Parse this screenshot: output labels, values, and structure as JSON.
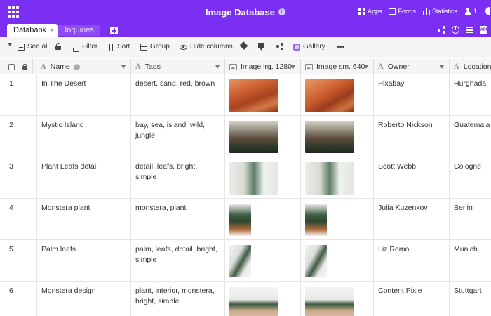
{
  "header": {
    "title": "Image Database",
    "apps_label": "Apps",
    "forms_label": "Forms",
    "statistics_label": "Statistics",
    "user_count": "1"
  },
  "tabs": [
    {
      "label": "Databank",
      "active": true
    },
    {
      "label": "Inquiries",
      "active": false
    }
  ],
  "toolbar": {
    "see_all": "See all",
    "filter": "Filter",
    "sort": "Sort",
    "group": "Group",
    "hide_columns": "Hide columns",
    "gallery": "Gallery"
  },
  "columns": {
    "name": "Name",
    "tags": "Tags",
    "image_lrg": "Image lrg. 1280",
    "image_sm": "Image sm. 640",
    "owner": "Owner",
    "location": "Location"
  },
  "rows": [
    {
      "num": "1",
      "name": "In The Desert",
      "tags": "desert, sand, red, brown",
      "owner": "Pixabay",
      "location": "Hurghada",
      "image": "desert"
    },
    {
      "num": "2",
      "name": "Mystic Island",
      "tags": "bay, sea, island, wild, jungle",
      "owner": "Roberto Nickson",
      "location": "Guatemala",
      "image": "island"
    },
    {
      "num": "3",
      "name": "Plant Leafs detail",
      "tags": "detail, leafs, bright, simple",
      "owner": "Scott Webb",
      "location": "Cologne",
      "image": "leaf"
    },
    {
      "num": "4",
      "name": "Monstera plant",
      "tags": "monstera, plant",
      "owner": "Julia Kuzenkov",
      "location": "Berlin",
      "image": "monstera"
    },
    {
      "num": "5",
      "name": "Palm leafs",
      "tags": "palm, leafs, detail, bright, simple",
      "owner": "Liz Romo",
      "location": "Munich",
      "image": "palm"
    },
    {
      "num": "6",
      "name": "Monstera design",
      "tags": "plant, interior, monstera, bright, simple",
      "owner": "Content Pixie",
      "location": "Stuttgart",
      "image": "design"
    }
  ],
  "colors": {
    "brand": "#7b2ff2",
    "toolbar_bg": "#f5f5f5"
  },
  "icons": [
    "grid-icon",
    "info-icon",
    "apps-icon",
    "forms-icon",
    "statistics-icon",
    "user-icon",
    "share-icon",
    "history-icon",
    "settings-icon",
    "developer-icon",
    "caret-down-icon",
    "list-icon",
    "lock-icon",
    "filter-icon",
    "sort-icon",
    "group-icon",
    "eye-icon",
    "paint-bucket-icon",
    "comment-icon",
    "gallery-icon",
    "more-icon",
    "checkbox-icon",
    "text-column-icon",
    "image-column-icon"
  ]
}
